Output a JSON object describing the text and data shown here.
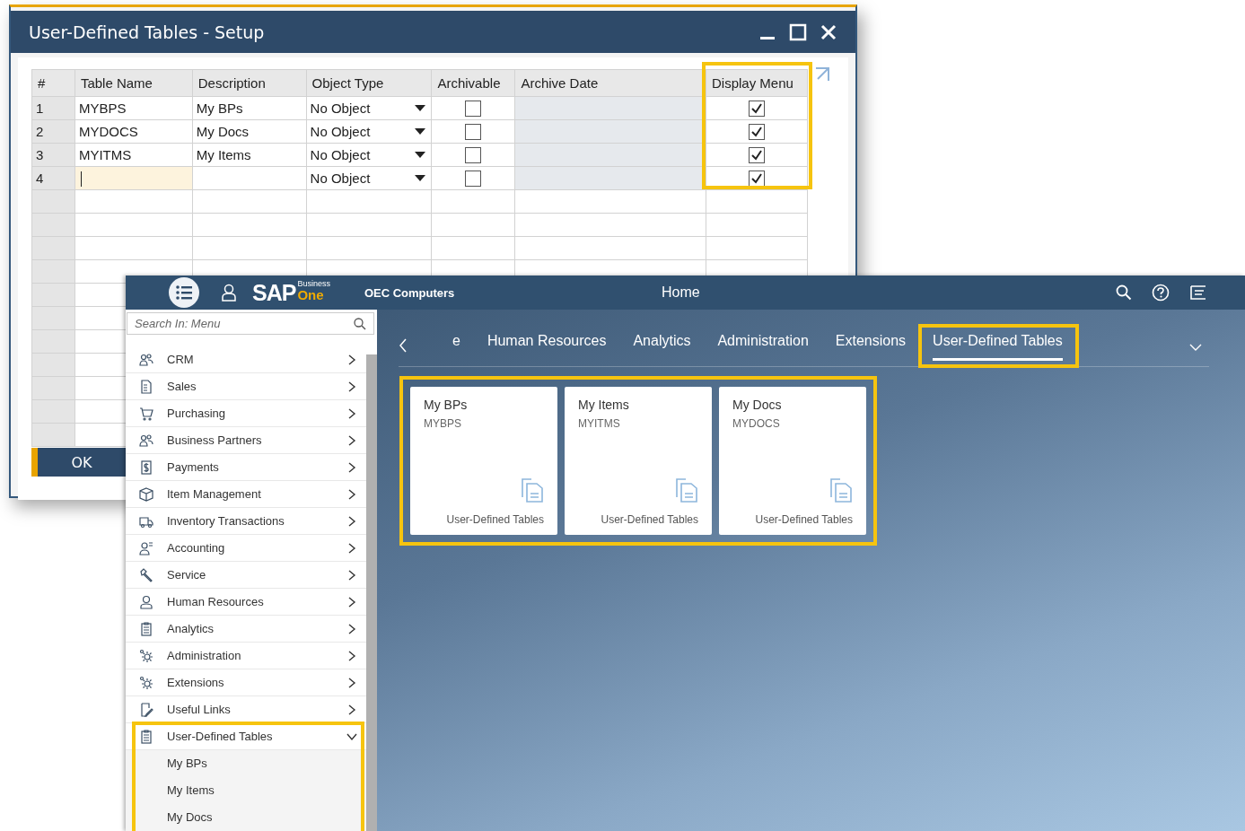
{
  "setup_window": {
    "title": "User-Defined Tables - Setup",
    "columns": [
      {
        "label": "#",
        "highlighted": false
      },
      {
        "label": "Table Name",
        "highlighted": false
      },
      {
        "label": "Description",
        "highlighted": false
      },
      {
        "label": "Object Type",
        "highlighted": false
      },
      {
        "label": "Archivable",
        "highlighted": false
      },
      {
        "label": "Archive Date",
        "highlighted": false
      },
      {
        "label": "Display Menu",
        "highlighted": true
      }
    ],
    "rows": [
      {
        "number": "1",
        "table_name": "MYBPS",
        "description": "My BPs",
        "object_type": "No Object",
        "archivable": false,
        "display_menu": true,
        "editing": false
      },
      {
        "number": "2",
        "table_name": "MYDOCS",
        "description": "My Docs",
        "object_type": "No Object",
        "archivable": false,
        "display_menu": true,
        "editing": false
      },
      {
        "number": "3",
        "table_name": "MYITMS",
        "description": "My Items",
        "object_type": "No Object",
        "archivable": false,
        "display_menu": true,
        "editing": false
      },
      {
        "number": "4",
        "object_type": "No Object",
        "archivable": false,
        "display_menu": true,
        "editing": true
      }
    ],
    "ok_button": "OK"
  },
  "client": {
    "logo": {
      "brand": "SAP",
      "line1": "Business",
      "line2": "One"
    },
    "company": "OEC Computers",
    "page_title": "Home",
    "search": {
      "placeholder": "Search In: Menu"
    },
    "menu": [
      {
        "label": "CRM",
        "expanded": false,
        "highlighted": false
      },
      {
        "label": "Sales",
        "expanded": false,
        "highlighted": false
      },
      {
        "label": "Purchasing",
        "expanded": false,
        "highlighted": false
      },
      {
        "label": "Business Partners",
        "expanded": false,
        "highlighted": false
      },
      {
        "label": "Payments",
        "expanded": false,
        "highlighted": false
      },
      {
        "label": "Item Management",
        "expanded": false,
        "highlighted": false
      },
      {
        "label": "Inventory Transactions",
        "expanded": false,
        "highlighted": false
      },
      {
        "label": "Accounting",
        "expanded": false,
        "highlighted": false
      },
      {
        "label": "Service",
        "expanded": false,
        "highlighted": false
      },
      {
        "label": "Human Resources",
        "expanded": false,
        "highlighted": false
      },
      {
        "label": "Analytics",
        "expanded": false,
        "highlighted": false
      },
      {
        "label": "Administration",
        "expanded": false,
        "highlighted": false
      },
      {
        "label": "Extensions",
        "expanded": false,
        "highlighted": false
      },
      {
        "label": "Useful Links",
        "expanded": false,
        "highlighted": false
      },
      {
        "label": "User-Defined Tables",
        "expanded": true,
        "highlighted": true,
        "children": [
          {
            "label": "My BPs"
          },
          {
            "label": "My Items"
          },
          {
            "label": "My Docs"
          }
        ]
      }
    ],
    "tabs": [
      {
        "label": "e",
        "selected": false,
        "highlighted": false
      },
      {
        "label": "Human Resources",
        "selected": false,
        "highlighted": false
      },
      {
        "label": "Analytics",
        "selected": false,
        "highlighted": false
      },
      {
        "label": "Administration",
        "selected": false,
        "highlighted": false
      },
      {
        "label": "Extensions",
        "selected": false,
        "highlighted": false
      },
      {
        "label": "User-Defined Tables",
        "selected": true,
        "highlighted": true
      }
    ],
    "tiles_highlighted": true,
    "tiles": [
      {
        "title": "My BPs",
        "code": "MYBPS",
        "footer": "User-Defined Tables"
      },
      {
        "title": "My Items",
        "code": "MYITMS",
        "footer": "User-Defined Tables"
      },
      {
        "title": "My Docs",
        "code": "MYDOCS",
        "footer": "User-Defined Tables"
      }
    ]
  }
}
